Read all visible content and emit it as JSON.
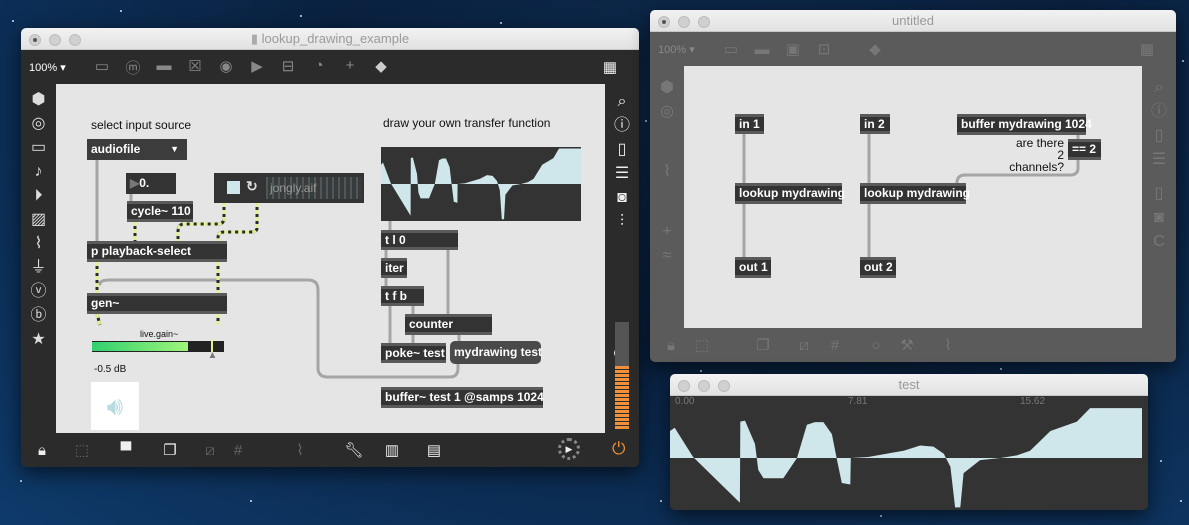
{
  "main_window": {
    "title": "lookup_drawing_example",
    "zoom": "100%",
    "toolbar_icons": [
      "patcher-window",
      "message-box",
      "comment",
      "toggle",
      "button",
      "play",
      "slider",
      "dial",
      "plus",
      "paint-bucket",
      "grid"
    ],
    "left_sidebar_icons": [
      "cube",
      "circle-target",
      "film",
      "music-note",
      "step-play",
      "image",
      "paperclip",
      "plug",
      "v-circle",
      "b-circle",
      "star"
    ],
    "right_sidebar_icons": [
      "search",
      "info",
      "book",
      "list",
      "camera",
      "mixer"
    ],
    "bottom_icons": [
      "lock",
      "select-pointer",
      "presentation",
      "windows",
      "hide-cords",
      "grid",
      "paperclip-add",
      "wrench",
      "piano",
      "keyboard"
    ],
    "comments": {
      "select_source": "select input source",
      "draw": "draw your own transfer function",
      "gain_label": "live.gain~",
      "gain_value": "-0.5 dB"
    },
    "menu": {
      "value": "audiofile"
    },
    "number_box": "0.",
    "playlist_file": "jongly.aif",
    "objects": {
      "cycle": "cycle~ 110",
      "playback": "p playback-select",
      "gen": "gen~",
      "tl0": "t l 0",
      "iter": "iter",
      "tfb": "t f b",
      "counter": "counter",
      "poke": "poke~ test",
      "buffer": "buffer~ test 1 @samps 1024"
    },
    "message": "mydrawing test",
    "gain_level": 0.73,
    "gain_slider": 0.92
  },
  "untitled_window": {
    "title": "untitled",
    "zoom": "100%",
    "objects": {
      "in1": "in 1",
      "in2": "in 2",
      "buffer": "buffer mydrawing 1024",
      "eq": "== 2",
      "lookup1": "lookup mydrawing",
      "lookup2": "lookup mydrawing",
      "out1": "out 1",
      "out2": "out 2"
    },
    "comment": "are there 2 channels?"
  },
  "test_window": {
    "title": "test",
    "ruler": [
      "0.00",
      "7.81",
      "15.62"
    ]
  },
  "curve": [
    [
      0,
      0.52
    ],
    [
      0.01,
      0.58
    ],
    [
      0.049,
      0.02
    ],
    [
      0.148,
      -0.86
    ],
    [
      0.149,
      0.7
    ],
    [
      0.159,
      0.72
    ],
    [
      0.18,
      0.27
    ],
    [
      0.187,
      -0.23
    ],
    [
      0.198,
      -0.39
    ],
    [
      0.24,
      -0.39
    ],
    [
      0.269,
      0
    ],
    [
      0.29,
      0.64
    ],
    [
      0.307,
      0.69
    ],
    [
      0.325,
      0.69
    ],
    [
      0.343,
      0.46
    ],
    [
      0.353,
      0
    ],
    [
      0.364,
      -0.48
    ],
    [
      0.382,
      -0.51
    ],
    [
      0.383,
      0
    ],
    [
      0.42,
      0.02
    ],
    [
      0.495,
      0.14
    ],
    [
      0.53,
      0.24
    ],
    [
      0.558,
      0.22
    ],
    [
      0.58,
      0.08
    ],
    [
      0.594,
      -0.17
    ],
    [
      0.604,
      -0.95
    ],
    [
      0.615,
      -0.95
    ],
    [
      0.622,
      -0.29
    ],
    [
      0.657,
      -0.04
    ],
    [
      0.7,
      0
    ],
    [
      0.735,
      0.05
    ],
    [
      0.763,
      0.14
    ],
    [
      0.806,
      0.52
    ],
    [
      0.862,
      0.7
    ],
    [
      0.89,
      0.96
    ],
    [
      1,
      0.96
    ]
  ],
  "colors": {
    "wave": "#cfe6ea",
    "accent": "#f0913a",
    "signal": "#e4ef8e"
  }
}
